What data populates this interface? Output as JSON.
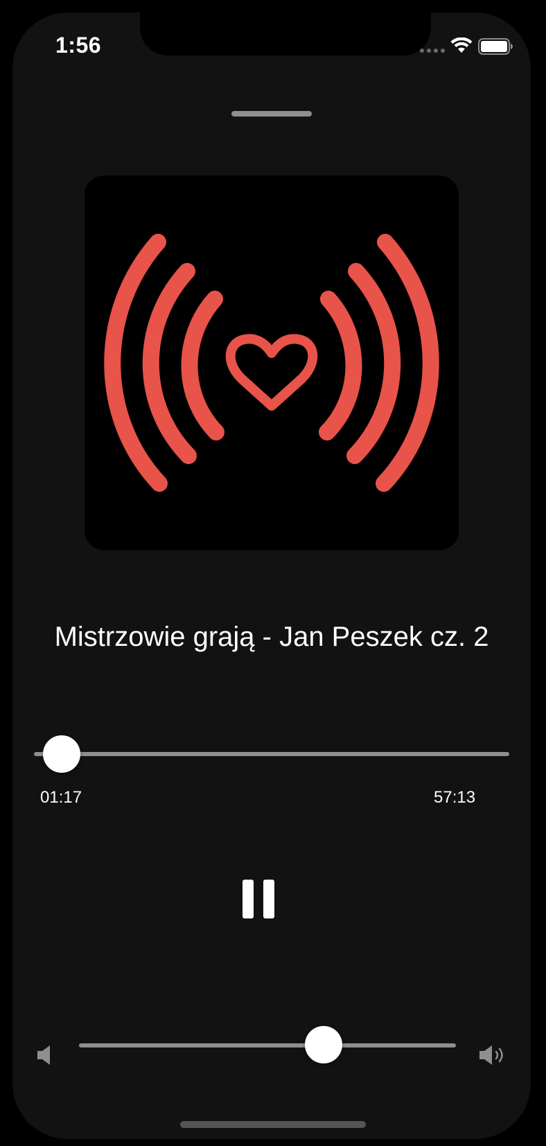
{
  "status_bar": {
    "time": "1:56"
  },
  "colors": {
    "accent": "#e8534a",
    "background": "#121212",
    "artwork_background": "#000000",
    "track": "#8e8e93",
    "thumb": "#ffffff"
  },
  "player": {
    "title": "Mistrzowie grają - Jan Peszek cz. 2",
    "elapsed": "01:17",
    "duration": "57:13",
    "progress_fraction": 0.022,
    "volume_fraction": 0.67,
    "play_state": "playing",
    "pause_icon": "pause-icon"
  },
  "icons": {
    "artwork": "broadcast-heart-icon",
    "volume_low": "speaker-low-icon",
    "volume_high": "speaker-high-icon",
    "wifi": "wifi-icon",
    "battery": "battery-icon",
    "signal": "cellular-signal-icon"
  }
}
